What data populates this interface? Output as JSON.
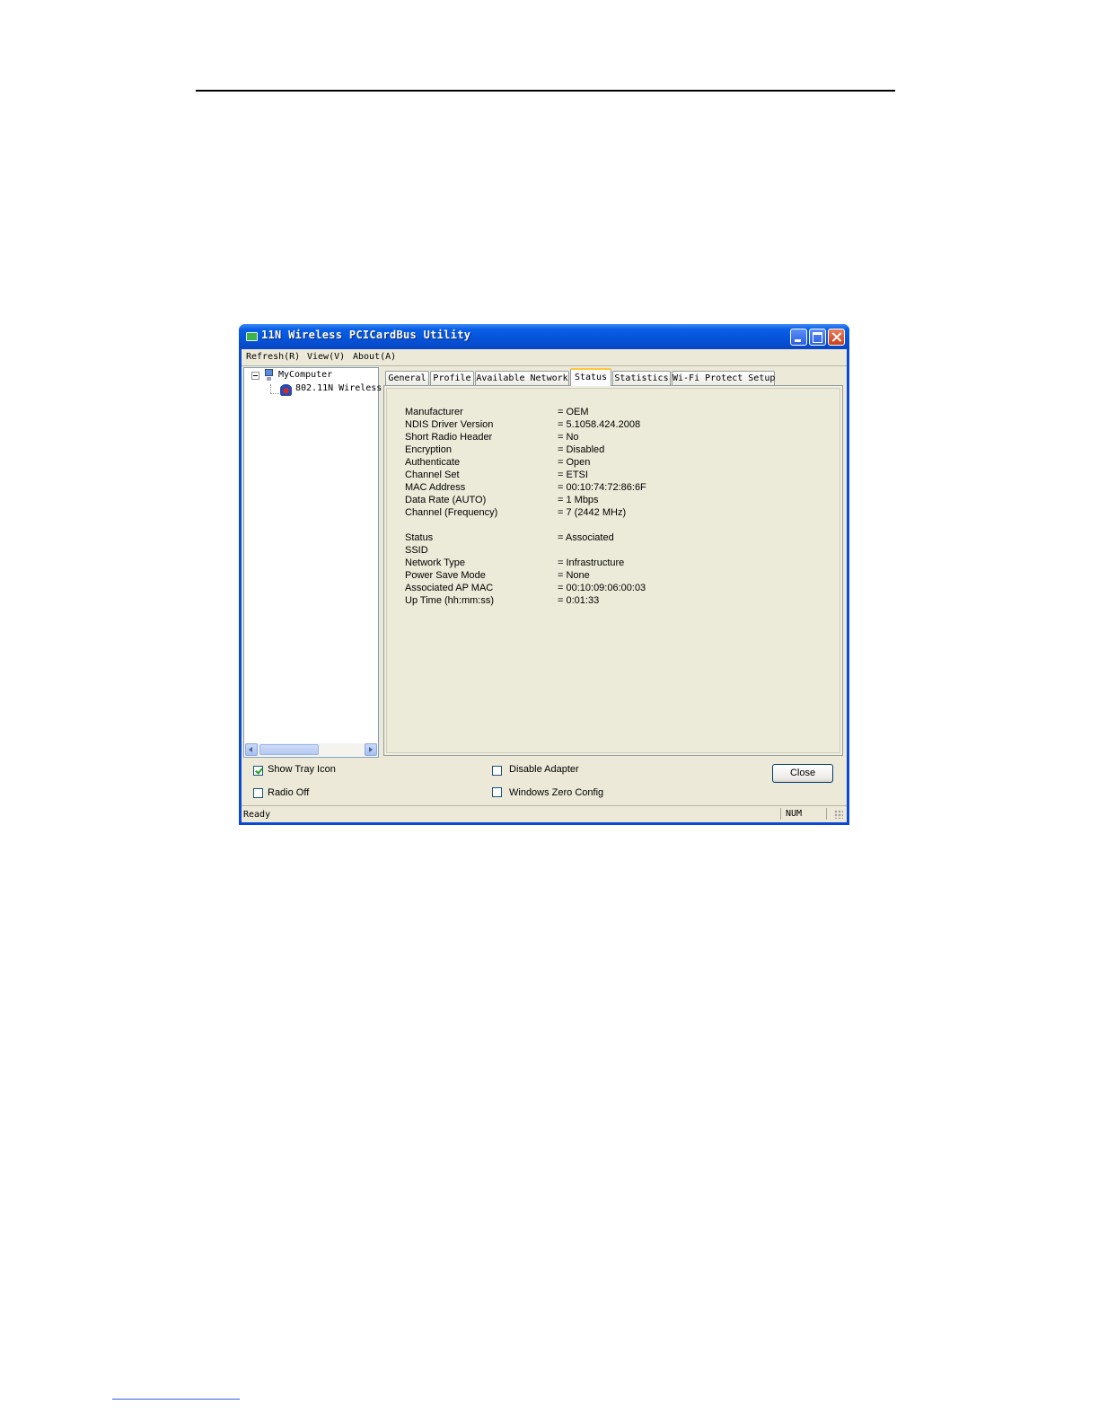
{
  "window": {
    "title": "11N Wireless PCICardBus Utility"
  },
  "menu": [
    "Refresh(R)",
    "View(V)",
    "About(A)"
  ],
  "tree": {
    "root": "MyComputer",
    "child": "802.11N Wireless"
  },
  "tabs": [
    "General",
    "Profile",
    "Available Network",
    "Status",
    "Statistics",
    "Wi-Fi Protect Setup"
  ],
  "active_tab": "Status",
  "status_info": [
    {
      "label": "Manufacturer",
      "value": "= OEM"
    },
    {
      "label": "NDIS Driver Version",
      "value": "= 5.1058.424.2008"
    },
    {
      "label": "Short Radio Header",
      "value": "= No"
    },
    {
      "label": "Encryption",
      "value": "= Disabled"
    },
    {
      "label": "Authenticate",
      "value": "= Open"
    },
    {
      "label": "Channel Set",
      "value": "= ETSI"
    },
    {
      "label": "MAC Address",
      "value": "= 00:10:74:72:86:6F"
    },
    {
      "label": "Data Rate (AUTO)",
      "value": "= 1 Mbps"
    },
    {
      "label": "Channel (Frequency)",
      "value": "= 7 (2442 MHz)"
    },
    {
      "label": "Status",
      "value": "= Associated"
    },
    {
      "label": "SSID",
      "value": ""
    },
    {
      "label": "Network Type",
      "value": "= Infrastructure"
    },
    {
      "label": "Power Save Mode",
      "value": "= None"
    },
    {
      "label": "Associated AP MAC",
      "value": "= 00:10:09:06:00:03"
    },
    {
      "label": "Up Time (hh:mm:ss)",
      "value": "= 0:01:33"
    }
  ],
  "options": {
    "show_tray_icon": {
      "label": "Show Tray Icon",
      "checked": true
    },
    "radio_off": {
      "label": "Radio Off",
      "checked": false
    },
    "disable_adapter": {
      "label": "Disable Adapter",
      "checked": false
    },
    "windows_zero_config": {
      "label": "Windows Zero Config",
      "checked": false
    }
  },
  "buttons": {
    "close": "Close"
  },
  "statusbar": {
    "text": "Ready",
    "indicator": "NUM"
  }
}
